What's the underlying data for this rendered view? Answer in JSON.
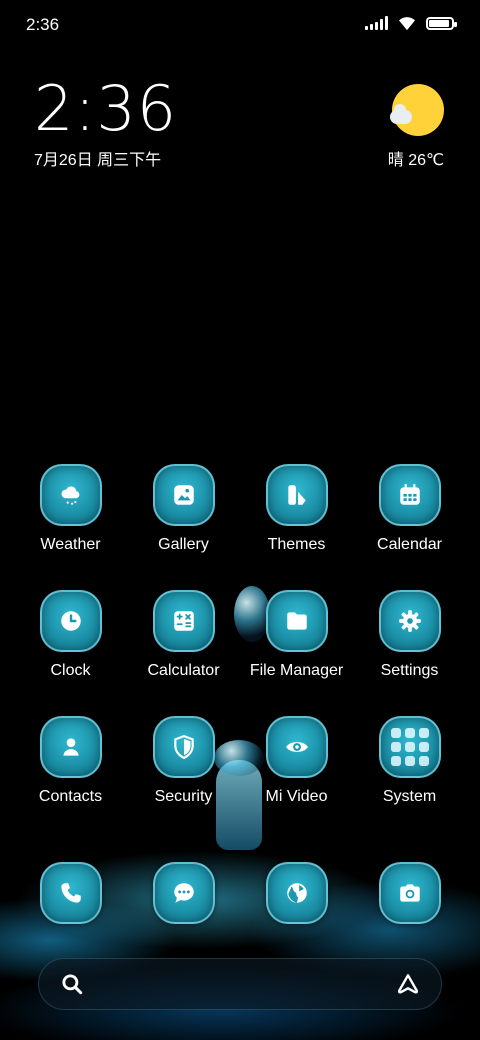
{
  "status_bar": {
    "time": "2:36",
    "icons": [
      "signal-icon",
      "wifi-icon",
      "battery-icon"
    ],
    "battery_level": 0.9
  },
  "clock_widget": {
    "time": "2:36",
    "date": "7月26日 周三下午"
  },
  "weather_widget": {
    "icon": "sun-cloud-icon",
    "text": "晴 26℃"
  },
  "apps": [
    {
      "label": "Weather",
      "icon": "weather-icon"
    },
    {
      "label": "Gallery",
      "icon": "gallery-icon"
    },
    {
      "label": "Themes",
      "icon": "themes-icon"
    },
    {
      "label": "Calendar",
      "icon": "calendar-icon"
    },
    {
      "label": "Clock",
      "icon": "clock-icon"
    },
    {
      "label": "Calculator",
      "icon": "calculator-icon"
    },
    {
      "label": "File Manager",
      "icon": "folder-icon"
    },
    {
      "label": "Settings",
      "icon": "gear-icon"
    },
    {
      "label": "Contacts",
      "icon": "contacts-icon"
    },
    {
      "label": "Security",
      "icon": "shield-icon"
    },
    {
      "label": "Mi Video",
      "icon": "eye-icon"
    },
    {
      "label": "System",
      "icon": "folder-grid-icon"
    }
  ],
  "dock": [
    {
      "icon": "phone-icon"
    },
    {
      "icon": "message-icon"
    },
    {
      "icon": "browser-icon"
    },
    {
      "icon": "camera-icon"
    }
  ],
  "search_bar": {
    "left_icon": "search-icon",
    "right_icon": "assistant-icon"
  },
  "colors": {
    "icon_teal": "#1b97b0",
    "sun": "#ffd23a",
    "background": "#000000"
  }
}
